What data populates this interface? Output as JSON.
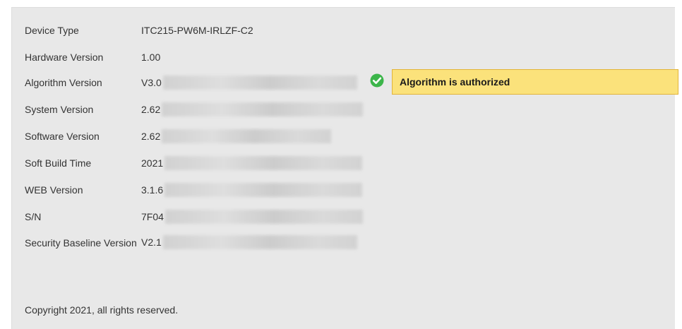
{
  "device_info": {
    "rows": [
      {
        "label": "Device Type",
        "value": "ITC215-PW6M-IRLZF-C2"
      },
      {
        "label": "Hardware Version",
        "value": "1.00"
      },
      {
        "label": "Algorithm Version",
        "value": "V3.0"
      },
      {
        "label": "System Version",
        "value": "2.62"
      },
      {
        "label": "Software Version",
        "value": "2.62"
      },
      {
        "label": "Soft Build Time",
        "value": "2021"
      },
      {
        "label": "WEB Version",
        "value": "3.1.6"
      },
      {
        "label": "S/N",
        "value": "7F04"
      },
      {
        "label": "Security Baseline Version",
        "value": "V2.1"
      }
    ]
  },
  "authorization": {
    "status_text": "Algorithm is authorized",
    "icon": "check-circle-icon",
    "icon_color": "#3cb54a",
    "box_color": "#fbe27b",
    "box_border_color": "#e2b43a"
  },
  "footer": {
    "copyright": "Copyright 2021, all rights reserved."
  }
}
